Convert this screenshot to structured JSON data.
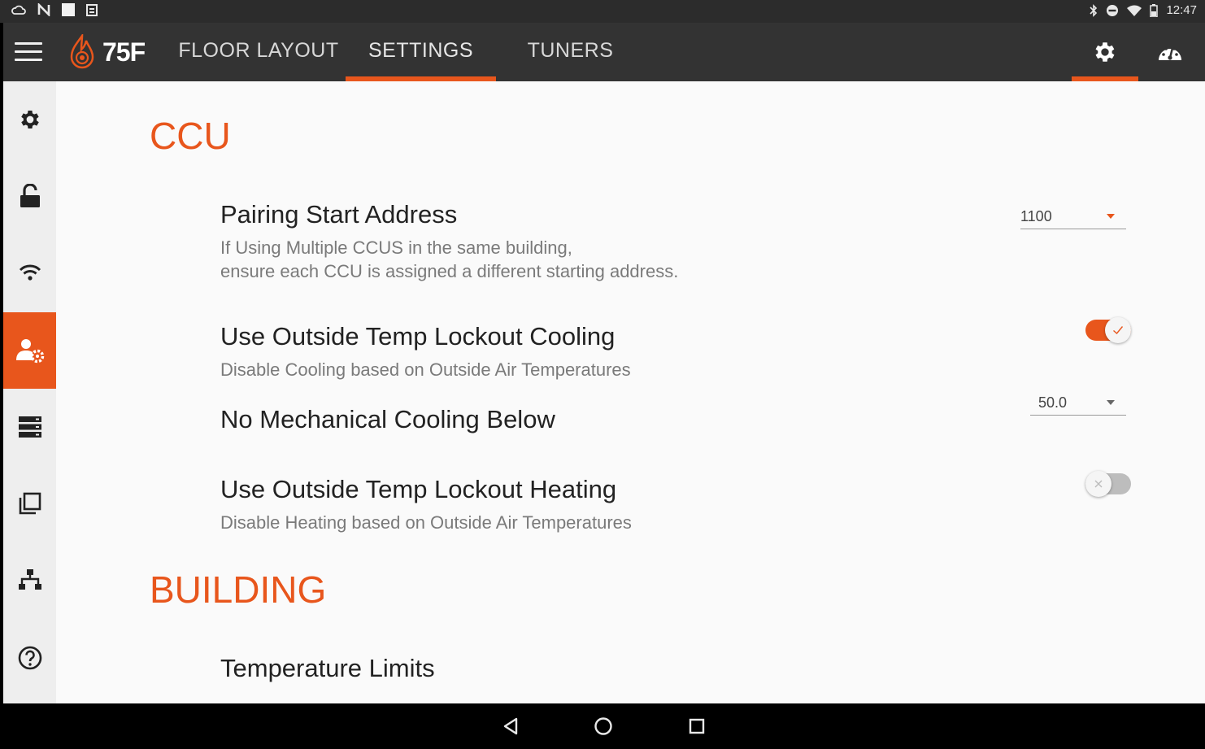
{
  "status_bar": {
    "time": "12:47",
    "left_icons": [
      "cloud-icon",
      "nfc-icon",
      "notification-square-icon",
      "clipboard-icon"
    ],
    "right_icons": [
      "bluetooth-icon",
      "do-not-disturb-icon",
      "wifi-icon",
      "battery-icon"
    ]
  },
  "app_bar": {
    "logo_text": "75F",
    "tabs": [
      {
        "label": "FLOOR LAYOUT",
        "active": false
      },
      {
        "label": "SETTINGS",
        "active": true
      },
      {
        "label": "TUNERS",
        "active": false
      }
    ],
    "right_icons": [
      {
        "icon": "gear-icon",
        "active": true
      },
      {
        "icon": "dashboard-gauge-icon",
        "active": false
      }
    ]
  },
  "side_rail": {
    "items": [
      {
        "icon": "gear-icon",
        "active": false
      },
      {
        "icon": "unlock-icon",
        "active": false
      },
      {
        "icon": "wifi-icon",
        "active": false
      },
      {
        "icon": "user-settings-icon",
        "active": true
      },
      {
        "icon": "server-list-icon",
        "active": false
      },
      {
        "icon": "copy-icon",
        "active": false
      },
      {
        "icon": "hierarchy-icon",
        "active": false
      },
      {
        "icon": "help-icon",
        "active": false
      }
    ]
  },
  "ccu_section": {
    "title": "CCU",
    "pairing": {
      "title": "Pairing Start Address",
      "desc_line1": "If Using Multiple CCUS in the same building,",
      "desc_line2": "ensure each CCU is assigned a different starting address.",
      "value": "1100"
    },
    "cooling_lockout": {
      "title": "Use Outside Temp Lockout Cooling",
      "desc": "Disable Cooling based on Outside Air Temperatures",
      "enabled": true
    },
    "no_mech_cooling": {
      "title": "No Mechanical Cooling Below",
      "value": "50.0"
    },
    "heating_lockout": {
      "title": "Use Outside Temp Lockout Heating",
      "desc": "Disable Heating based on Outside Air Temperatures",
      "enabled": false
    }
  },
  "building_section": {
    "title": "BUILDING",
    "temperature_limits": {
      "title": "Temperature Limits"
    }
  },
  "nav_bar": {
    "buttons": [
      "back-icon",
      "home-icon",
      "recents-icon"
    ]
  },
  "colors": {
    "accent": "#e8561c",
    "app_bar": "#333333",
    "status_bar": "#2c2c2c",
    "content_bg": "#fafafa",
    "rail_bg": "#eeeeee"
  }
}
